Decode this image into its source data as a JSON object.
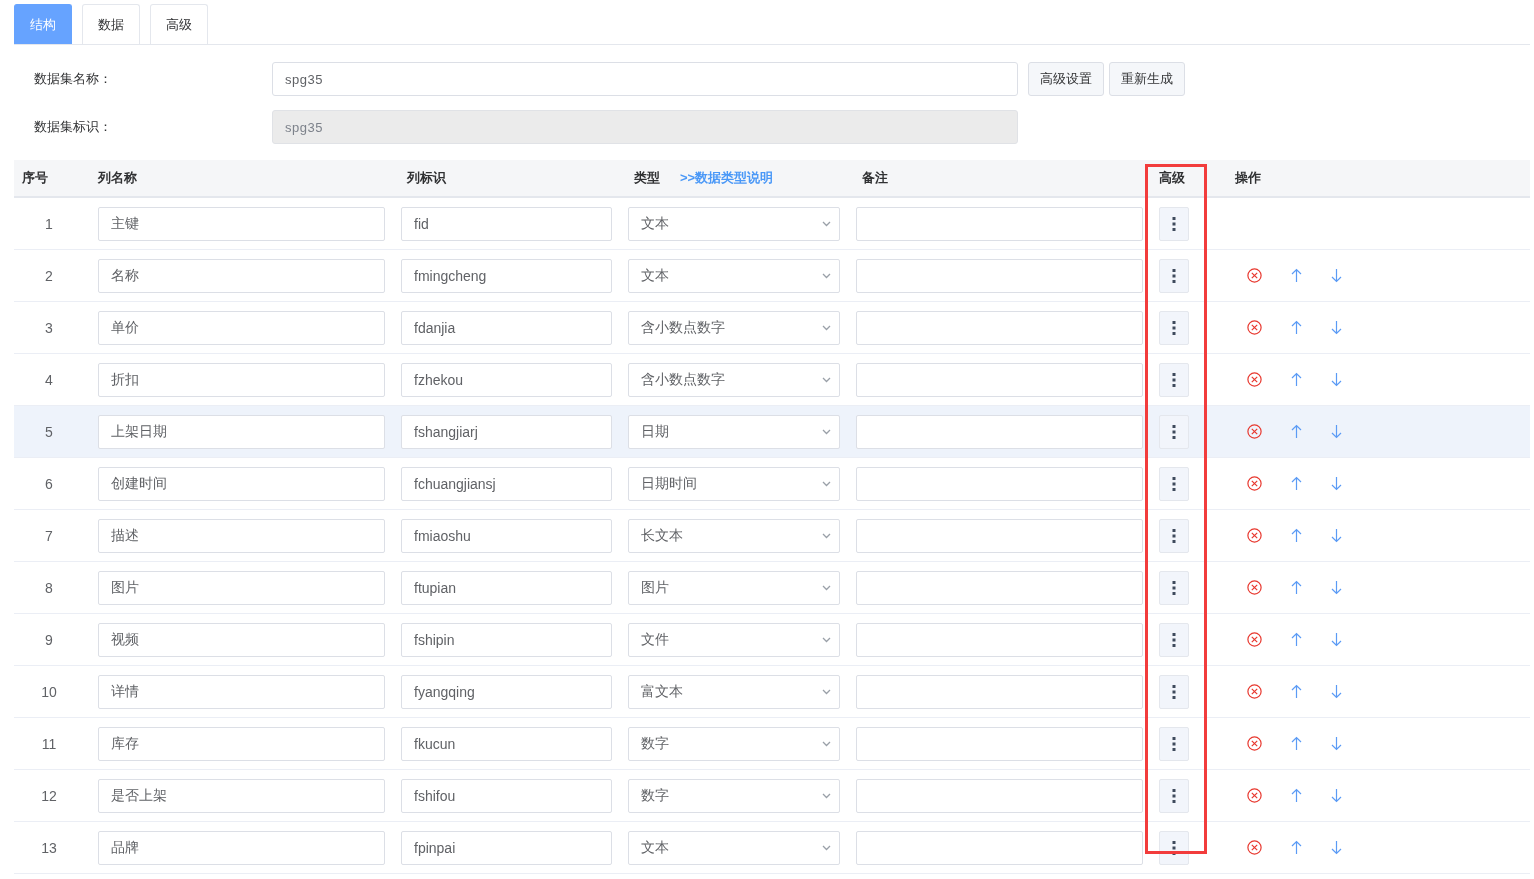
{
  "tabs": [
    {
      "label": "结构",
      "selected": true
    },
    {
      "label": "数据",
      "selected": false
    },
    {
      "label": "高级",
      "selected": false
    }
  ],
  "form": [
    {
      "label": "数据集名称：",
      "value": "spg35",
      "disabled": false
    },
    {
      "label": "数据集标识：",
      "value": "spg35",
      "disabled": true
    }
  ],
  "form_buttons": [
    "高级设置",
    "重新生成"
  ],
  "table": {
    "columns": [
      {
        "label": "序号"
      },
      {
        "label": "列名称"
      },
      {
        "label": "列标识"
      },
      {
        "label": "类型",
        "link": ">>数据类型说明"
      },
      {
        "label": "备注"
      },
      {
        "label": "高级",
        "outlined": true
      },
      {
        "label": "操作"
      }
    ],
    "rows": [
      {
        "index": "1",
        "name": "主键",
        "key": "fid",
        "type": "文本",
        "hovered": false,
        "actions": false
      },
      {
        "index": "2",
        "name": "名称",
        "key": "fmingcheng",
        "type": "文本",
        "hovered": false,
        "actions": true
      },
      {
        "index": "3",
        "name": "单价",
        "key": "fdanjia",
        "type": "含小数点数字",
        "hovered": false,
        "actions": true
      },
      {
        "index": "4",
        "name": "折扣",
        "key": "fzhekou",
        "type": "含小数点数字",
        "hovered": false,
        "actions": true
      },
      {
        "index": "5",
        "name": "上架日期",
        "key": "fshangjiarj",
        "type": "日期",
        "hovered": true,
        "actions": true
      },
      {
        "index": "6",
        "name": "创建时间",
        "key": "fchuangjiansj",
        "type": "日期时间",
        "hovered": false,
        "actions": true
      },
      {
        "index": "7",
        "name": "描述",
        "key": "fmiaoshu",
        "type": "长文本",
        "hovered": false,
        "actions": true
      },
      {
        "index": "8",
        "name": "图片",
        "key": "ftupian",
        "type": "图片",
        "hovered": false,
        "actions": true
      },
      {
        "index": "9",
        "name": "视频",
        "key": "fshipin",
        "type": "文件",
        "hovered": false,
        "actions": true
      },
      {
        "index": "10",
        "name": "详情",
        "key": "fyangqing",
        "type": "富文本",
        "hovered": false,
        "actions": true
      },
      {
        "index": "11",
        "name": "库存",
        "key": "fkucun",
        "type": "数字",
        "hovered": false,
        "actions": true
      },
      {
        "index": "12",
        "name": "是否上架",
        "key": "fshifou",
        "type": "数字",
        "hovered": false,
        "actions": true
      },
      {
        "index": "13",
        "name": "品牌",
        "key": "fpinpai",
        "type": "文本",
        "hovered": false,
        "actions": true
      }
    ]
  }
}
